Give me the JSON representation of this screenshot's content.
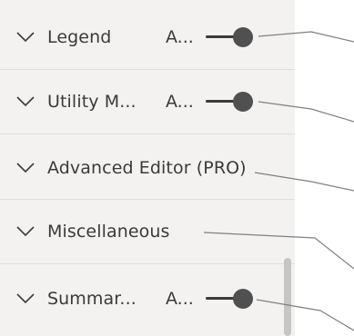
{
  "panel": {
    "sections": [
      {
        "label": "Legend",
        "state": "A...",
        "has_toggle": true
      },
      {
        "label": "Utility M...",
        "state": "A...",
        "has_toggle": true
      },
      {
        "label": "Advanced Editor (PRO)",
        "state": "",
        "has_toggle": false
      },
      {
        "label": "Miscellaneous",
        "state": "",
        "has_toggle": false
      },
      {
        "label": "Summar...",
        "state": "A...",
        "has_toggle": true
      }
    ],
    "chevron_icon": "chevron-down-icon"
  },
  "colors": {
    "panel_background": "#f3f2f1",
    "text": "#3b3a39",
    "toggle_knob": "#505050",
    "callout_line": "#808080",
    "divider": "#e1dfdd"
  }
}
